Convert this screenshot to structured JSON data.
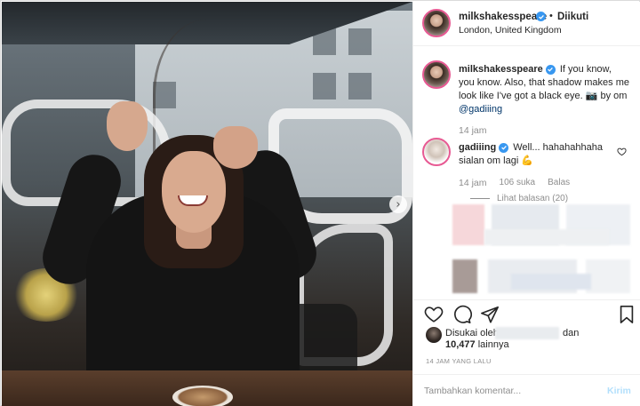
{
  "header": {
    "username": "milkshakesspeare",
    "separator": "•",
    "follow_status": "Diikuti",
    "location": "London, United Kingdom"
  },
  "caption": {
    "username": "milkshakesspeare",
    "text": "If you know, you know. Also, that shadow makes me look like I've got a black eye. 📷 by om ",
    "mention": "@gadiiing",
    "time": "14 jam"
  },
  "comment": {
    "username": "gadiiing",
    "text": "Well... hahahahhaha sialan om lagi 💪",
    "time": "14 jam",
    "likes": "106 suka",
    "reply_label": "Balas",
    "view_replies": "Lihat balasan (20)"
  },
  "likes": {
    "prefix": "Disukai oleh",
    "and": "dan",
    "count": "10,477",
    "others": "lainnya"
  },
  "post_time": "14 JAM YANG LALU",
  "comment_box": {
    "placeholder": "Tambahkan komentar...",
    "post_label": "Kirim"
  },
  "photo": {
    "next_arrow": "›"
  },
  "colors": {
    "verified": "#3897f0",
    "story_ring": "#e75a93",
    "post_disabled": "#b2dffc",
    "muted": "#8e8e8e"
  },
  "icons": [
    "verified-badge-icon",
    "heart-icon",
    "comment-icon",
    "share-icon",
    "bookmark-icon",
    "chevron-right-icon"
  ]
}
